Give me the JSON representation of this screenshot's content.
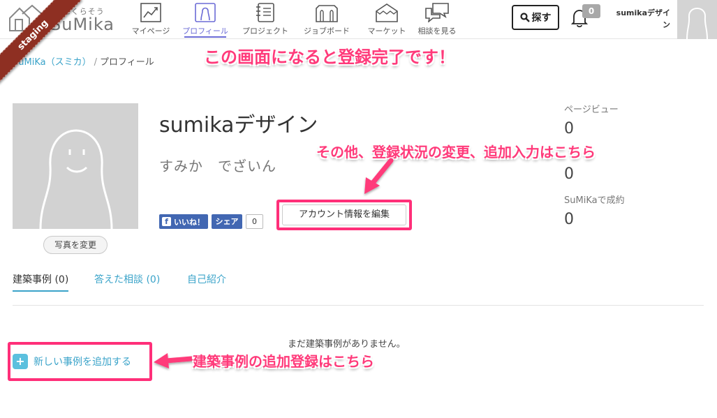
{
  "header": {
    "logo_tagline": "好きにくらそう",
    "logo_text": "SuMika",
    "nav": [
      {
        "label": "マイページ",
        "icon": "chart-trend-icon"
      },
      {
        "label": "プロフィール",
        "icon": "person-icon",
        "active": true
      },
      {
        "label": "プロジェクト",
        "icon": "notebook-icon"
      },
      {
        "label": "ジョブボード",
        "icon": "board-icon"
      },
      {
        "label": "マーケット",
        "icon": "tent-icon"
      },
      {
        "label": "相談を見る",
        "icon": "chat-bubbles-icon"
      }
    ],
    "search_label": "探す",
    "notification_count": "0",
    "user_name": "sumikaデザイン"
  },
  "ribbon": "staging",
  "breadcrumb": {
    "home": "SuMiKa（スミカ）",
    "separator": "/",
    "current": "プロフィール"
  },
  "annotations": {
    "top": "この画面になると登録完了です！",
    "middle": "その他、登録状況の変更、追加入力はこちら",
    "bottom": "建築事例の追加登録はこちら"
  },
  "profile": {
    "name": "sumikaデザイン",
    "kana": "すみか　でざいん",
    "change_photo_label": "写真を変更",
    "edit_account_label": "アカウント情報を編集",
    "facebook": {
      "like_label": "いいね！",
      "share_label": "シェア",
      "count": "0"
    }
  },
  "stats": [
    {
      "label": "ページビュー",
      "value": "0"
    },
    {
      "label": "",
      "value": "0"
    },
    {
      "label": "SuMiKaで成約",
      "value": "0"
    }
  ],
  "tabs": [
    {
      "label": "建築事例 (0)",
      "active": true
    },
    {
      "label": "答えた相談 (0)"
    },
    {
      "label": "自己紹介"
    }
  ],
  "empty_message": "まだ建築事例がありません。",
  "add_case_label": "新しい事例を追加する",
  "colors": {
    "accent": "#3aa3c9",
    "nav_active": "#6b6bd6",
    "annotation": "#ff3a7a",
    "ribbon": "#8e2f22",
    "facebook": "#4267b2"
  }
}
